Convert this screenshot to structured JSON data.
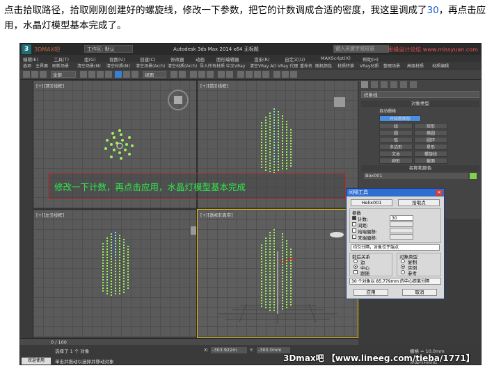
{
  "caption": {
    "before": "点击拾取路径，拾取刚刚创建好的螺旋线，修改一下参数，把它的计数调成合适的密度，我这里调成了",
    "number": "30",
    "after": "，再点击应用，水晶灯模型基本完成了。"
  },
  "app": {
    "logo": "3",
    "watermark_top_left": "3DMAX吧",
    "workspace": "工作区: 默认",
    "title": "Autodesk 3ds Max  2014 x64        无标题",
    "search_placeholder": "键入关键字或短语",
    "watermark_top_right": "思缘设计论坛 www.missyuan.com",
    "menu": [
      "编辑(E)",
      "工具(T)",
      "组(G)",
      "视图(V)",
      "创建(C)",
      "修改器",
      "动画",
      "图形编辑器",
      "渲染(R)",
      "自定义(U)",
      "MAXScript(X)",
      "帮助(H)"
    ],
    "subtabs": [
      "选项",
      "主界面",
      "刷新场景",
      "清空场景(M)",
      "清空材质(M)",
      "清空场景(Arch)",
      "清空材质(Arch)",
      "导入所有材质",
      "中文VRay",
      "清空VRay AO",
      "VRay 代理",
      "重命名",
      "随机颜色",
      "材质转换",
      "VRay材质",
      "整理场景",
      "高级材质",
      "材质编辑"
    ],
    "toolbar_selection": "全部",
    "toolbar_view": "视图",
    "viewports": {
      "top_left": "[+][顶][线框]",
      "top_right": "[+][前][线框]",
      "bottom_left": "[+][左][线框]",
      "bottom_right": "[+][透视][真实]"
    },
    "banner": "修改一下计数，再点击应用，水晶灯模型基本完成",
    "command_panel": {
      "dropdown": "样条线",
      "object_type_header": "对象类型",
      "auto_grid": "自动栅格",
      "start_new_shape": "开始新图形",
      "buttons": [
        "线",
        "矩形",
        "圆",
        "椭圆",
        "弧",
        "圆环",
        "多边形",
        "星形",
        "文本",
        "螺旋线",
        "卵形",
        "截面"
      ],
      "name_color_header": "名称和颜色",
      "object_name": "Box001",
      "object_color": "#7ed24e"
    },
    "spacing_tool": {
      "title": "间隔工具",
      "pick_path": "Helix001",
      "pick_points": "拾取点",
      "params_label": "参数",
      "count_label": "计数:",
      "count_value": "30",
      "spacing_label": "间距:",
      "start_offset_label": "始端偏移:",
      "end_offset_label": "末端偏移:",
      "distribution": "均匀分隔，对象位于端点",
      "context_label": "前后关系",
      "context_options": [
        "边",
        "中心",
        "跟随"
      ],
      "object_type_label": "对象类型",
      "object_type_options": [
        "复制",
        "实例",
        "参考"
      ],
      "status": "30 个对象以 85.779mm 的中心距离分隔",
      "apply": "应用",
      "cancel": "取消"
    },
    "timeline": {
      "frame": "0 / 100"
    },
    "statusbar": {
      "welcome": "欢迎使用 MAXSc",
      "selected": "选择了 1 个 对象",
      "hint": "单击并拖动以选择并移动对象",
      "x_label": "X:",
      "x_value": "-303.922m",
      "y_label": "Y:",
      "y_value": "-300.0mm",
      "grid": "栅格 = 10.0mm",
      "add_time_tag": "添加时间标记",
      "watermark_bottom": "3Dmax吧 【www.lineeg.com/tieba/1771】"
    }
  }
}
